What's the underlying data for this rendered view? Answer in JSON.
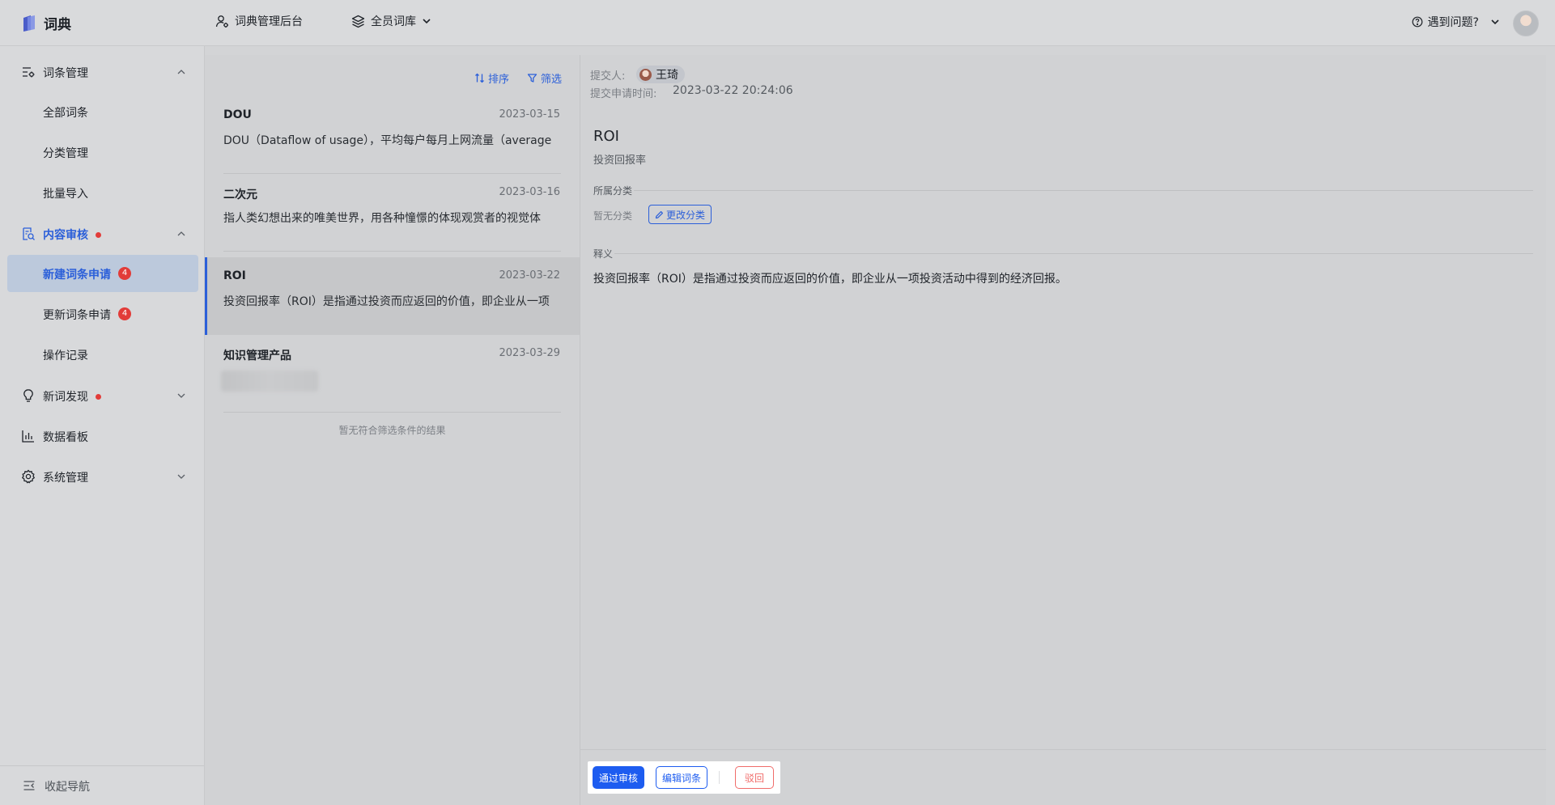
{
  "topbar": {
    "app_name": "词典",
    "admin_label": "词典管理后台",
    "library_label": "全员词库",
    "help_label": "遇到问题?"
  },
  "sidebar": {
    "groups": [
      {
        "label": "词条管理",
        "icon": "list-settings-icon"
      },
      {
        "label": "内容审核",
        "icon": "audit-icon"
      },
      {
        "label": "新词发现",
        "icon": "lightbulb-icon"
      },
      {
        "label": "数据看板",
        "icon": "bar-chart-icon"
      },
      {
        "label": "系统管理",
        "icon": "gear-icon"
      }
    ],
    "items": [
      {
        "label": "全部词条"
      },
      {
        "label": "分类管理"
      },
      {
        "label": "批量导入"
      },
      {
        "label": "新建词条申请",
        "badge": "4"
      },
      {
        "label": "更新词条申请",
        "badge": "4"
      },
      {
        "label": "操作记录"
      }
    ],
    "collapse_label": "收起导航"
  },
  "list": {
    "sort_label": "排序",
    "filter_label": "筛选",
    "entries": [
      {
        "title": "DOU",
        "date": "2023-03-15",
        "desc": "DOU（Dataflow of usage），平均每户每月上网流量（average"
      },
      {
        "title": "二次元",
        "date": "2023-03-16",
        "desc": "指人类幻想出来的唯美世界，用各种憧憬的体现观赏者的视觉体"
      },
      {
        "title": "ROI",
        "date": "2023-03-22",
        "desc": "投资回报率（ROI）是指通过投资而应返回的价值，即企业从一项"
      },
      {
        "title": "知识管理产品",
        "date": "2023-03-29",
        "desc": ""
      }
    ],
    "empty_text": "暂无符合筛选条件的结果"
  },
  "detail": {
    "submitter_label": "提交人:",
    "submitter_name": "王琦",
    "time_label": "提交申请时间:",
    "time_value": "2023-03-22 20:24:06",
    "term": "ROI",
    "term_sub": "投资回报率",
    "category_title": "所属分类",
    "no_category": "暂无分类",
    "change_category": "更改分类",
    "definition_title": "释义",
    "definition": "投资回报率（ROI）是指通过投资而应返回的价值，即企业从一项投资活动中得到的经济回报。",
    "approve_label": "通过审核",
    "edit_label": "编辑词条",
    "reject_label": "驳回"
  },
  "colors": {
    "accent": "#2b5fd9",
    "primary_button": "#1d5cf0",
    "danger": "#f06c6a",
    "badge": "#e23c39"
  }
}
